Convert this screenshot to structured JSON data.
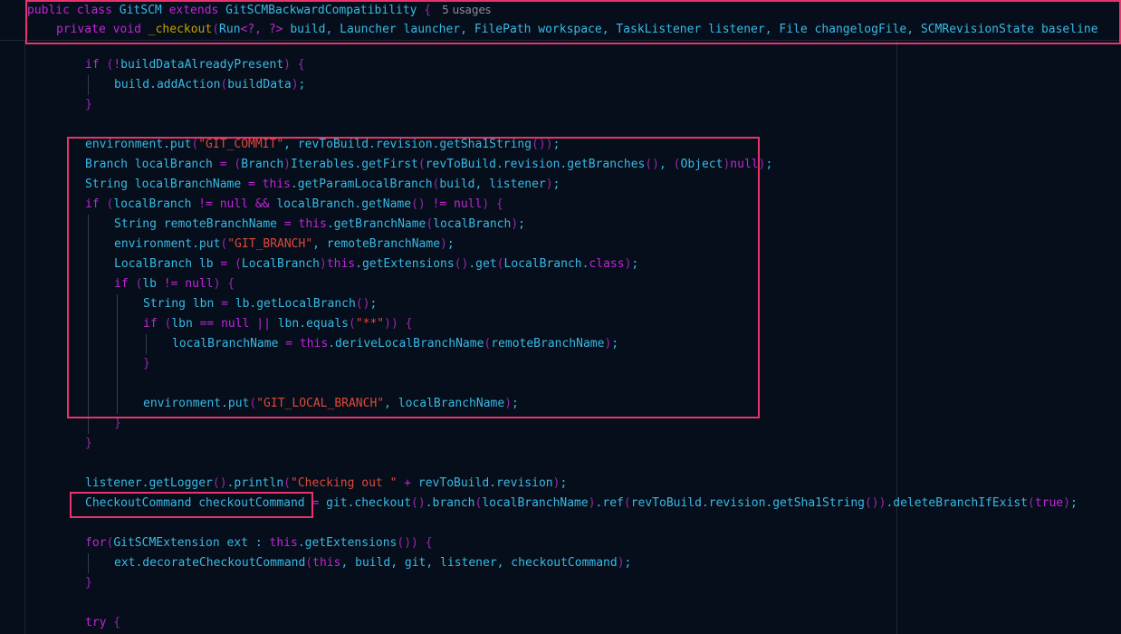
{
  "sticky": {
    "line1": [
      {
        "t": "public",
        "c": "kw"
      },
      {
        "t": " ",
        "c": "plain"
      },
      {
        "t": "class",
        "c": "kw"
      },
      {
        "t": " GitSCM ",
        "c": "plain"
      },
      {
        "t": "extends",
        "c": "kw"
      },
      {
        "t": " GitSCMBackwardCompatibility ",
        "c": "plain"
      },
      {
        "t": "{",
        "c": "par"
      }
    ],
    "usages_hint": "5 usages",
    "line2": [
      {
        "t": "private",
        "c": "kw"
      },
      {
        "t": " ",
        "c": "plain"
      },
      {
        "t": "void",
        "c": "kw"
      },
      {
        "t": " ",
        "c": "plain"
      },
      {
        "t": "_checkout",
        "c": "fn"
      },
      {
        "t": "(",
        "c": "par"
      },
      {
        "t": "Run",
        "c": "plain"
      },
      {
        "t": "<?, ?>",
        "c": "op"
      },
      {
        "t": " build, Launcher launcher, FilePath workspace, TaskListener listener, File changelogFile, SCMRevisionState baseline",
        "c": "plain"
      }
    ]
  },
  "lines": [
    {
      "indent": 2,
      "tokens": [
        {
          "t": "if",
          "c": "kw"
        },
        {
          "t": " (",
          "c": "par"
        },
        {
          "t": "!",
          "c": "op"
        },
        {
          "t": "buildDataAlreadyPresent",
          "c": "plain"
        },
        {
          "t": ")",
          "c": "par"
        },
        {
          "t": " {",
          "c": "par"
        }
      ]
    },
    {
      "indent": 3,
      "tokens": [
        {
          "t": "build.addAction",
          "c": "plain"
        },
        {
          "t": "(",
          "c": "par"
        },
        {
          "t": "buildData",
          "c": "plain"
        },
        {
          "t": ")",
          "c": "par"
        },
        {
          "t": ";",
          "c": "plain"
        }
      ]
    },
    {
      "indent": 2,
      "tokens": [
        {
          "t": "}",
          "c": "par"
        }
      ]
    },
    {
      "indent": 0,
      "tokens": []
    },
    {
      "indent": 2,
      "tokens": [
        {
          "t": "environment.put",
          "c": "plain"
        },
        {
          "t": "(",
          "c": "par"
        },
        {
          "t": "\"GIT_COMMIT\"",
          "c": "str"
        },
        {
          "t": ", revToBuild.revision.getSha1String",
          "c": "plain"
        },
        {
          "t": "())",
          "c": "par"
        },
        {
          "t": ";",
          "c": "plain"
        }
      ]
    },
    {
      "indent": 2,
      "tokens": [
        {
          "t": "Branch localBranch ",
          "c": "plain"
        },
        {
          "t": "=",
          "c": "op"
        },
        {
          "t": " (",
          "c": "par"
        },
        {
          "t": "Branch",
          "c": "plain"
        },
        {
          "t": ")",
          "c": "par"
        },
        {
          "t": "Iterables.getFirst",
          "c": "plain"
        },
        {
          "t": "(",
          "c": "par"
        },
        {
          "t": "revToBuild.revision.getBranches",
          "c": "plain"
        },
        {
          "t": "()",
          "c": "par"
        },
        {
          "t": ", ",
          "c": "plain"
        },
        {
          "t": "(",
          "c": "par"
        },
        {
          "t": "Object",
          "c": "plain"
        },
        {
          "t": ")",
          "c": "par"
        },
        {
          "t": "null",
          "c": "kw"
        },
        {
          "t": ")",
          "c": "par"
        },
        {
          "t": ";",
          "c": "plain"
        }
      ]
    },
    {
      "indent": 2,
      "tokens": [
        {
          "t": "String localBranchName ",
          "c": "plain"
        },
        {
          "t": "=",
          "c": "op"
        },
        {
          "t": " ",
          "c": "plain"
        },
        {
          "t": "this",
          "c": "kw"
        },
        {
          "t": ".getParamLocalBranch",
          "c": "plain"
        },
        {
          "t": "(",
          "c": "par"
        },
        {
          "t": "build, listener",
          "c": "plain"
        },
        {
          "t": ")",
          "c": "par"
        },
        {
          "t": ";",
          "c": "plain"
        }
      ]
    },
    {
      "indent": 2,
      "tokens": [
        {
          "t": "if",
          "c": "kw"
        },
        {
          "t": " (",
          "c": "par"
        },
        {
          "t": "localBranch ",
          "c": "plain"
        },
        {
          "t": "!=",
          "c": "op"
        },
        {
          "t": " ",
          "c": "plain"
        },
        {
          "t": "null",
          "c": "kw"
        },
        {
          "t": " ",
          "c": "plain"
        },
        {
          "t": "&&",
          "c": "op"
        },
        {
          "t": " localBranch.getName",
          "c": "plain"
        },
        {
          "t": "()",
          "c": "par"
        },
        {
          "t": " ",
          "c": "plain"
        },
        {
          "t": "!=",
          "c": "op"
        },
        {
          "t": " ",
          "c": "plain"
        },
        {
          "t": "null",
          "c": "kw"
        },
        {
          "t": ")",
          "c": "par"
        },
        {
          "t": " {",
          "c": "par"
        }
      ]
    },
    {
      "indent": 3,
      "tokens": [
        {
          "t": "String remoteBranchName ",
          "c": "plain"
        },
        {
          "t": "=",
          "c": "op"
        },
        {
          "t": " ",
          "c": "plain"
        },
        {
          "t": "this",
          "c": "kw"
        },
        {
          "t": ".getBranchName",
          "c": "plain"
        },
        {
          "t": "(",
          "c": "par"
        },
        {
          "t": "localBranch",
          "c": "plain"
        },
        {
          "t": ")",
          "c": "par"
        },
        {
          "t": ";",
          "c": "plain"
        }
      ]
    },
    {
      "indent": 3,
      "tokens": [
        {
          "t": "environment.put",
          "c": "plain"
        },
        {
          "t": "(",
          "c": "par"
        },
        {
          "t": "\"GIT_BRANCH\"",
          "c": "str"
        },
        {
          "t": ", remoteBranchName",
          "c": "plain"
        },
        {
          "t": ")",
          "c": "par"
        },
        {
          "t": ";",
          "c": "plain"
        }
      ]
    },
    {
      "indent": 3,
      "tokens": [
        {
          "t": "LocalBranch lb ",
          "c": "plain"
        },
        {
          "t": "=",
          "c": "op"
        },
        {
          "t": " (",
          "c": "par"
        },
        {
          "t": "LocalBranch",
          "c": "plain"
        },
        {
          "t": ")",
          "c": "par"
        },
        {
          "t": "this",
          "c": "kw"
        },
        {
          "t": ".getExtensions",
          "c": "plain"
        },
        {
          "t": "()",
          "c": "par"
        },
        {
          "t": ".get",
          "c": "plain"
        },
        {
          "t": "(",
          "c": "par"
        },
        {
          "t": "LocalBranch.",
          "c": "plain"
        },
        {
          "t": "class",
          "c": "kw"
        },
        {
          "t": ")",
          "c": "par"
        },
        {
          "t": ";",
          "c": "plain"
        }
      ]
    },
    {
      "indent": 3,
      "tokens": [
        {
          "t": "if",
          "c": "kw"
        },
        {
          "t": " (",
          "c": "par"
        },
        {
          "t": "lb ",
          "c": "plain"
        },
        {
          "t": "!=",
          "c": "op"
        },
        {
          "t": " ",
          "c": "plain"
        },
        {
          "t": "null",
          "c": "kw"
        },
        {
          "t": ")",
          "c": "par"
        },
        {
          "t": " {",
          "c": "par"
        }
      ]
    },
    {
      "indent": 4,
      "tokens": [
        {
          "t": "String lbn ",
          "c": "plain"
        },
        {
          "t": "=",
          "c": "op"
        },
        {
          "t": " lb.getLocalBranch",
          "c": "plain"
        },
        {
          "t": "()",
          "c": "par"
        },
        {
          "t": ";",
          "c": "plain"
        }
      ]
    },
    {
      "indent": 4,
      "tokens": [
        {
          "t": "if",
          "c": "kw"
        },
        {
          "t": " (",
          "c": "par"
        },
        {
          "t": "lbn ",
          "c": "plain"
        },
        {
          "t": "==",
          "c": "op"
        },
        {
          "t": " ",
          "c": "plain"
        },
        {
          "t": "null",
          "c": "kw"
        },
        {
          "t": " ",
          "c": "plain"
        },
        {
          "t": "||",
          "c": "op"
        },
        {
          "t": " lbn.equals",
          "c": "plain"
        },
        {
          "t": "(",
          "c": "par"
        },
        {
          "t": "\"**\"",
          "c": "str"
        },
        {
          "t": "))",
          "c": "par"
        },
        {
          "t": " {",
          "c": "par"
        }
      ]
    },
    {
      "indent": 5,
      "tokens": [
        {
          "t": "localBranchName ",
          "c": "plain"
        },
        {
          "t": "=",
          "c": "op"
        },
        {
          "t": " ",
          "c": "plain"
        },
        {
          "t": "this",
          "c": "kw"
        },
        {
          "t": ".deriveLocalBranchName",
          "c": "plain"
        },
        {
          "t": "(",
          "c": "par"
        },
        {
          "t": "remoteBranchName",
          "c": "plain"
        },
        {
          "t": ")",
          "c": "par"
        },
        {
          "t": ";",
          "c": "plain"
        }
      ]
    },
    {
      "indent": 4,
      "tokens": [
        {
          "t": "}",
          "c": "par"
        }
      ]
    },
    {
      "indent": 0,
      "tokens": []
    },
    {
      "indent": 4,
      "tokens": [
        {
          "t": "environment.put",
          "c": "plain"
        },
        {
          "t": "(",
          "c": "par"
        },
        {
          "t": "\"GIT_LOCAL_BRANCH\"",
          "c": "str"
        },
        {
          "t": ", localBranchName",
          "c": "plain"
        },
        {
          "t": ")",
          "c": "par"
        },
        {
          "t": ";",
          "c": "plain"
        }
      ]
    },
    {
      "indent": 3,
      "tokens": [
        {
          "t": "}",
          "c": "par"
        }
      ]
    },
    {
      "indent": 2,
      "tokens": [
        {
          "t": "}",
          "c": "par"
        }
      ]
    },
    {
      "indent": 0,
      "tokens": []
    },
    {
      "indent": 2,
      "tokens": [
        {
          "t": "listener.getLogger",
          "c": "plain"
        },
        {
          "t": "()",
          "c": "par"
        },
        {
          "t": ".println",
          "c": "plain"
        },
        {
          "t": "(",
          "c": "par"
        },
        {
          "t": "\"Checking out \"",
          "c": "str"
        },
        {
          "t": " ",
          "c": "plain"
        },
        {
          "t": "+",
          "c": "op"
        },
        {
          "t": " revToBuild.revision",
          "c": "plain"
        },
        {
          "t": ")",
          "c": "par"
        },
        {
          "t": ";",
          "c": "plain"
        }
      ]
    },
    {
      "indent": 2,
      "tokens": [
        {
          "t": "CheckoutCommand checkoutCommand ",
          "c": "plain"
        },
        {
          "t": "=",
          "c": "op"
        },
        {
          "t": " git.checkout",
          "c": "plain"
        },
        {
          "t": "()",
          "c": "par"
        },
        {
          "t": ".branch",
          "c": "plain"
        },
        {
          "t": "(",
          "c": "par"
        },
        {
          "t": "localBranchName",
          "c": "plain"
        },
        {
          "t": ")",
          "c": "par"
        },
        {
          "t": ".ref",
          "c": "plain"
        },
        {
          "t": "(",
          "c": "par"
        },
        {
          "t": "revToBuild.revision.getSha1String",
          "c": "plain"
        },
        {
          "t": "())",
          "c": "par"
        },
        {
          "t": ".deleteBranchIfExist",
          "c": "plain"
        },
        {
          "t": "(",
          "c": "par"
        },
        {
          "t": "true",
          "c": "kw"
        },
        {
          "t": ")",
          "c": "par"
        },
        {
          "t": ";",
          "c": "plain"
        }
      ]
    },
    {
      "indent": 0,
      "tokens": []
    },
    {
      "indent": 2,
      "tokens": [
        {
          "t": "for",
          "c": "kw"
        },
        {
          "t": "(",
          "c": "par"
        },
        {
          "t": "GitSCMExtension ext : ",
          "c": "plain"
        },
        {
          "t": "this",
          "c": "kw"
        },
        {
          "t": ".getExtensions",
          "c": "plain"
        },
        {
          "t": "())",
          "c": "par"
        },
        {
          "t": " {",
          "c": "par"
        }
      ]
    },
    {
      "indent": 3,
      "tokens": [
        {
          "t": "ext.decorateCheckoutCommand",
          "c": "plain"
        },
        {
          "t": "(",
          "c": "par"
        },
        {
          "t": "this",
          "c": "kw"
        },
        {
          "t": ", build, git, listener, checkoutCommand",
          "c": "plain"
        },
        {
          "t": ")",
          "c": "par"
        },
        {
          "t": ";",
          "c": "plain"
        }
      ]
    },
    {
      "indent": 2,
      "tokens": [
        {
          "t": "}",
          "c": "par"
        }
      ]
    },
    {
      "indent": 0,
      "tokens": []
    },
    {
      "indent": 2,
      "tokens": [
        {
          "t": "try",
          "c": "kw"
        },
        {
          "t": " {",
          "c": "par"
        }
      ]
    }
  ],
  "colors": {
    "background": "#050e1a",
    "highlight_border": "#e8336d",
    "keyword": "#c125d8",
    "identifier": "#39bae6",
    "string": "#e0483a",
    "function_name": "#c4a000"
  }
}
